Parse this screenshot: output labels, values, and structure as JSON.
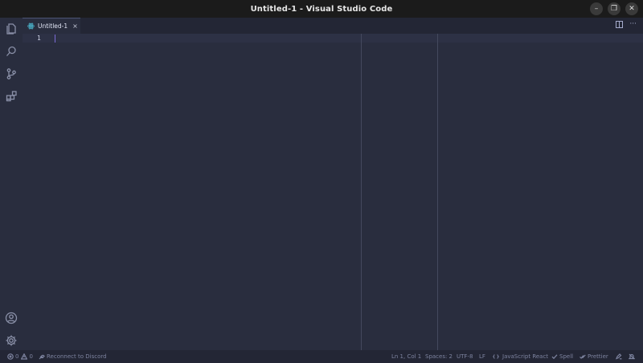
{
  "window": {
    "title": "Untitled-1 - Visual Studio Code",
    "controls": {
      "minimize": "–",
      "restore": "❐",
      "close": "✕"
    }
  },
  "activitybar": {
    "items": [
      "explorer-icon",
      "search-icon",
      "source-control-icon",
      "extensions-icon"
    ],
    "bottom": [
      "account-icon",
      "gear-icon"
    ]
  },
  "tab": {
    "label": "Untitled-1",
    "close": "×",
    "icon": "react-icon"
  },
  "editor_actions": {
    "more": "···"
  },
  "editor": {
    "line_number": "1"
  },
  "statusbar": {
    "errors": "0",
    "warnings": "0",
    "discord": "Reconnect to Discord",
    "position": "Ln 1, Col 1",
    "spaces": "Spaces: 2",
    "encoding": "UTF-8",
    "eol": "LF",
    "language": "JavaScript React",
    "spell": "Spell",
    "prettier": "Prettier"
  },
  "colors": {
    "background": "#292d3e",
    "titlebar": "#1b1b1b",
    "cursor": "#7c6bd6",
    "react": "#4fc3dc"
  }
}
